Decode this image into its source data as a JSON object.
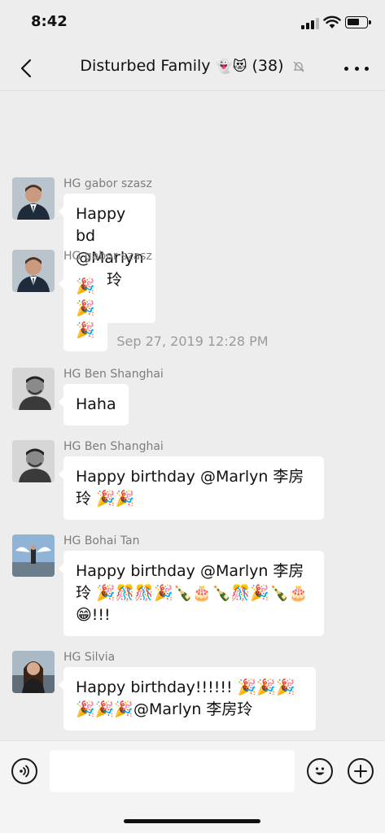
{
  "status_bar": {
    "time": "8:42"
  },
  "header": {
    "title": "Disturbed Family",
    "title_emoji": "👻😻",
    "member_count": "(38)"
  },
  "messages": [
    {
      "sender": "HG gabor szasz",
      "text": "Happy bd @Marlyn 李房玲 !!!"
    },
    {
      "sender": "HG gabor szasz",
      "text": "🎉🎉🎉"
    },
    {
      "sender": "HG Ben Shanghai",
      "text": "Haha"
    },
    {
      "sender": "HG Ben Shanghai",
      "text": "Happy birthday @Marlyn 李房玲 🎉🎉"
    },
    {
      "sender": "HG Bohai Tan",
      "text": "Happy birthday @Marlyn 李房玲 🎉🎊🎊🎉🍾🎂🍾🎊🎉🍾🎂😁!!!"
    },
    {
      "sender": "HG Silvia",
      "text": "Happy birthday!!!!!! 🎉🎉🎉🎉🎉🎉@Marlyn 李房玲"
    }
  ],
  "timestamp": "Sep 27, 2019 12:28 PM",
  "input": {
    "value": ""
  },
  "icons": [
    "back-icon",
    "mute-bell-icon",
    "more-icon",
    "voice-icon",
    "emoji-icon",
    "add-icon"
  ]
}
